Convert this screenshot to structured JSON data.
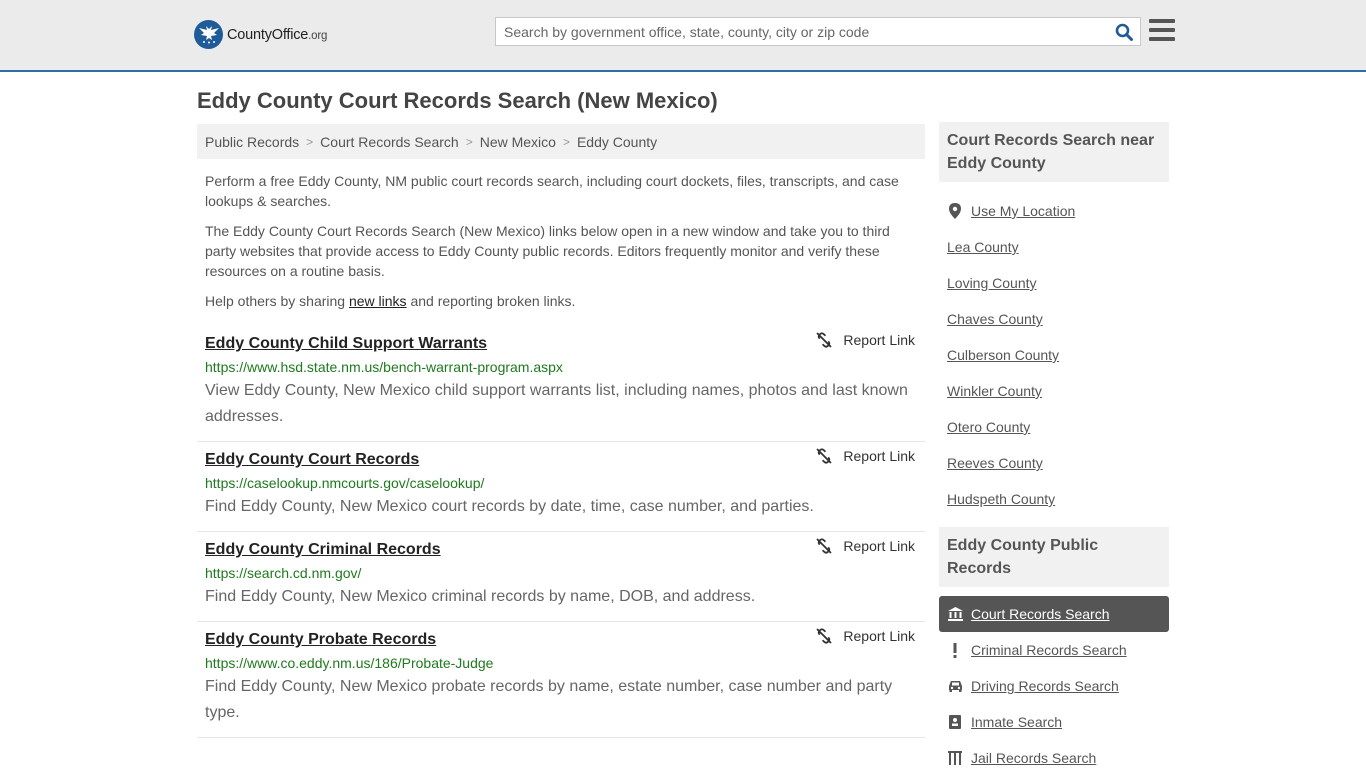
{
  "header": {
    "logo_name": "CountyOffice",
    "logo_tld": ".org",
    "search_placeholder": "Search by government office, state, county, city or zip code"
  },
  "page": {
    "title": "Eddy County Court Records Search (New Mexico)"
  },
  "breadcrumb": [
    "Public Records",
    "Court Records Search",
    "New Mexico",
    "Eddy County"
  ],
  "intro": {
    "p1": "Perform a free Eddy County, NM public court records search, including court dockets, files, transcripts, and case lookups & searches.",
    "p2": "The Eddy County Court Records Search (New Mexico) links below open in a new window and take you to third party websites that provide access to Eddy County public records. Editors frequently monitor and verify these resources on a routine basis.",
    "p3_before": "Help others by sharing ",
    "p3_link": "new links",
    "p3_after": " and reporting broken links."
  },
  "report_label": "Report Link",
  "results": [
    {
      "title": "Eddy County Child Support Warrants",
      "url": "https://www.hsd.state.nm.us/bench-warrant-program.aspx",
      "desc": "View Eddy County, New Mexico child support warrants list, including names, photos and last known addresses."
    },
    {
      "title": "Eddy County Court Records",
      "url": "https://caselookup.nmcourts.gov/caselookup/",
      "desc": "Find Eddy County, New Mexico court records by date, time, case number, and parties."
    },
    {
      "title": "Eddy County Criminal Records",
      "url": "https://search.cd.nm.gov/",
      "desc": "Find Eddy County, New Mexico criminal records by name, DOB, and address."
    },
    {
      "title": "Eddy County Probate Records",
      "url": "https://www.co.eddy.nm.us/186/Probate-Judge",
      "desc": "Find Eddy County, New Mexico probate records by name, estate number, case number and party type."
    }
  ],
  "sidebar": {
    "near_heading": "Court Records Search near Eddy County",
    "near_items": [
      "Use My Location",
      "Lea County",
      "Loving County",
      "Chaves County",
      "Culberson County",
      "Winkler County",
      "Otero County",
      "Reeves County",
      "Hudspeth County"
    ],
    "public_heading": "Eddy County Public Records",
    "public_items": [
      {
        "label": "Court Records Search",
        "icon": "courthouse-icon",
        "active": true
      },
      {
        "label": "Criminal Records Search",
        "icon": "exclamation-icon",
        "active": false
      },
      {
        "label": "Driving Records Search",
        "icon": "car-icon",
        "active": false
      },
      {
        "label": "Inmate Search",
        "icon": "id-badge-icon",
        "active": false
      },
      {
        "label": "Jail Records Search",
        "icon": "jail-icon",
        "active": false
      }
    ]
  },
  "colors": {
    "brand_blue": "#1f5a99",
    "url_green": "#1e7a1e",
    "active_bg": "#555555"
  }
}
